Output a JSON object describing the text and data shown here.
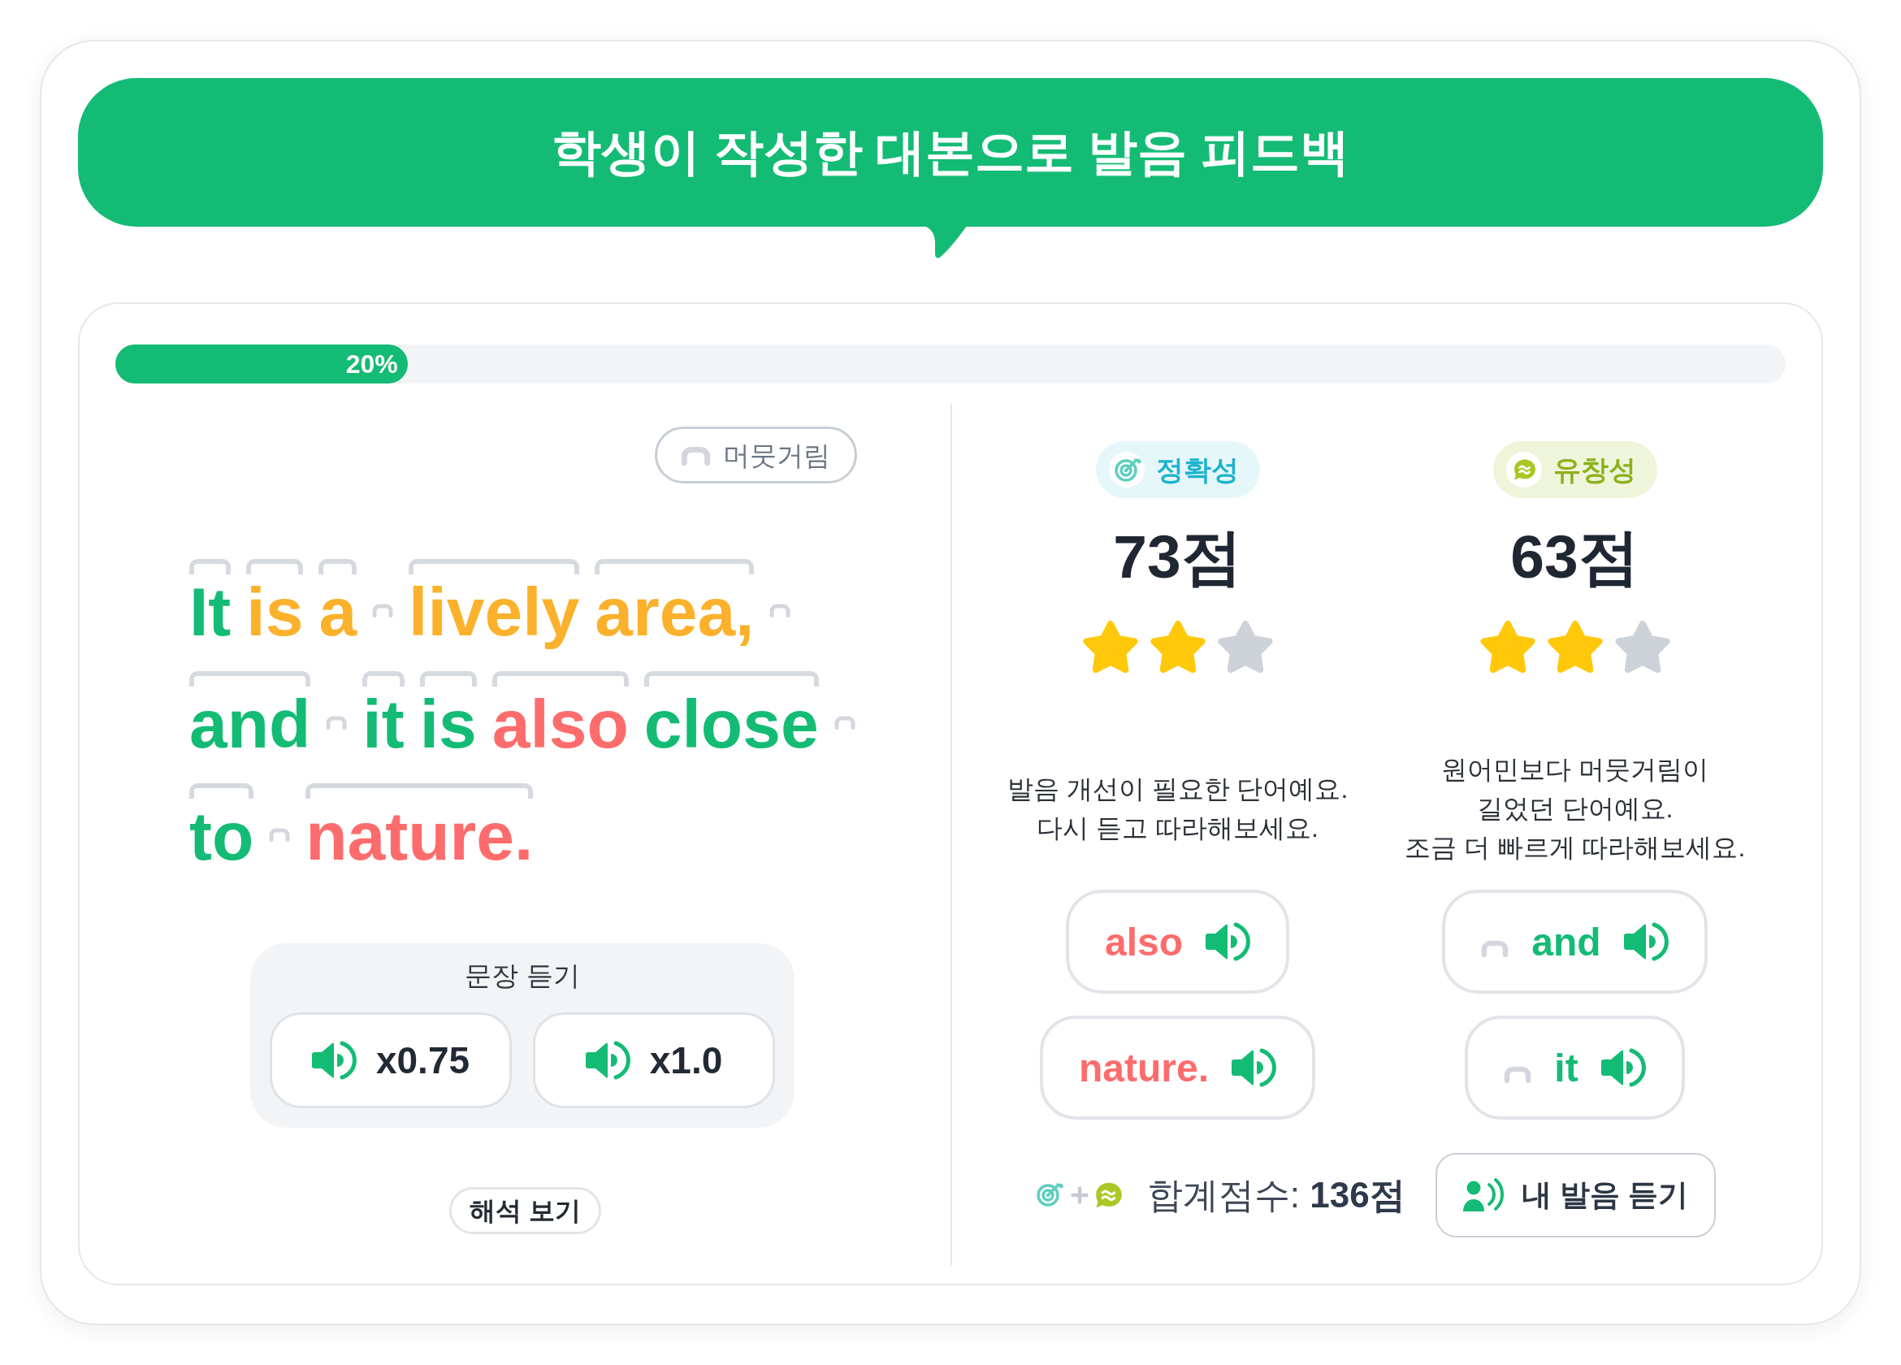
{
  "title": "학생이 작성한 대본으로 발음 피드백",
  "progress": {
    "level": 0.175,
    "label": "20%"
  },
  "legend": {
    "label": "머뭇거림"
  },
  "sentence": {
    "lines": [
      [
        {
          "kind": "word",
          "text": "It",
          "color": "#14bb75"
        },
        {
          "kind": "word",
          "text": "is",
          "color": "#fbb12b"
        },
        {
          "kind": "word",
          "text": "a",
          "color": "#fbb12b"
        },
        {
          "kind": "pause"
        },
        {
          "kind": "word",
          "text": "lively",
          "color": "#fbb12b"
        },
        {
          "kind": "word",
          "text": "area,",
          "color": "#fbb12b"
        },
        {
          "kind": "pause"
        }
      ],
      [
        {
          "kind": "word",
          "text": "and",
          "color": "#14bb75"
        },
        {
          "kind": "pause"
        },
        {
          "kind": "word",
          "text": "it",
          "color": "#14bb75"
        },
        {
          "kind": "word",
          "text": "is",
          "color": "#14bb75"
        },
        {
          "kind": "word",
          "text": "also",
          "color": "#fd6c6c"
        },
        {
          "kind": "word",
          "text": "close",
          "color": "#14bb75"
        },
        {
          "kind": "pause"
        }
      ],
      [
        {
          "kind": "word",
          "text": "to",
          "color": "#14bb75"
        },
        {
          "kind": "pause"
        },
        {
          "kind": "word",
          "text": "nature.",
          "color": "#fd6c6c"
        }
      ]
    ]
  },
  "listen": {
    "title": "문장 듣기",
    "buttons": [
      {
        "label": "x0.75"
      },
      {
        "label": "x1.0"
      }
    ]
  },
  "translation_button": {
    "label": "해석 보기"
  },
  "scores": [
    {
      "kind": "accuracy",
      "badge": "정확성",
      "score": "73점",
      "stars": 2,
      "message": "발음 개선이 필요한 단어예요.\n다시 듣고 따라해보세요.",
      "words": [
        {
          "text": "also",
          "color": "#fd6c6c",
          "pause": false
        },
        {
          "text": "nature.",
          "color": "#fd6c6c",
          "pause": false
        }
      ]
    },
    {
      "kind": "fluency",
      "badge": "유창성",
      "score": "63점",
      "stars": 2,
      "message": "원어민보다 머뭇거림이\n길었던 단어예요.\n조금 더 빠르게 따라해보세요.",
      "words": [
        {
          "text": "and",
          "color": "#14bb75",
          "pause": true
        },
        {
          "text": "it",
          "color": "#14bb75",
          "pause": true
        }
      ]
    }
  ],
  "total": {
    "label": "합계점수: **136점**"
  },
  "voice_button": {
    "label": "내 발음 듣기"
  }
}
